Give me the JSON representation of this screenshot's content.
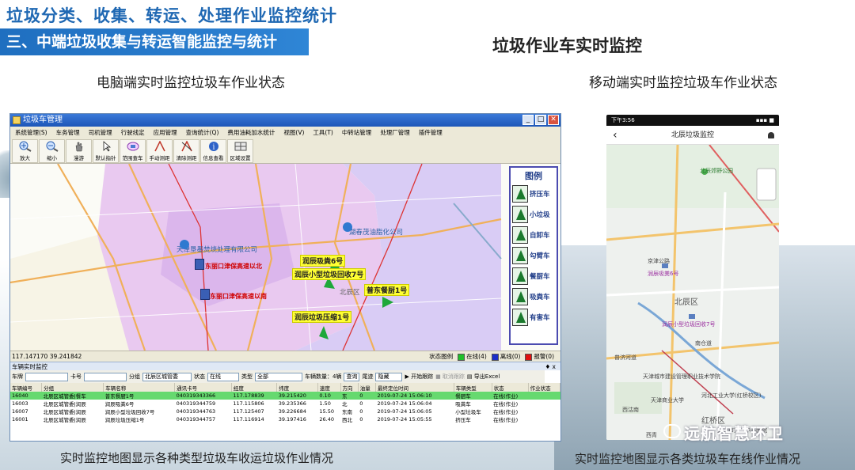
{
  "header": {
    "title": "垃圾分类、收集、转运、处理作业监控统计",
    "section": "三、中端垃圾收集与转运智能监控与统计",
    "right_title": "垃圾作业车实时监控"
  },
  "captions": {
    "pc": "电脑端实时监控垃圾车作业状态",
    "mobile": "移动端实时监控垃圾车作业状态",
    "pc_bottom": "实时监控地图显示各种类型垃圾车收运垃圾作业情况",
    "mobile_bottom": "实时监控地图显示各类垃圾车在线作业情况"
  },
  "window": {
    "title": "垃圾车管理",
    "buttons": [
      "_",
      "□",
      "✕"
    ],
    "menu": [
      "系统管理(S)",
      "车务管理",
      "司机管理",
      "行驶线定",
      "应用管理",
      "查询统计(Q)",
      "费用油耗加水统计",
      "视图(V)",
      "工具(T)",
      "中转站管理",
      "处理厂管理",
      "插件管理"
    ],
    "toolbar": [
      "放大",
      "缩小",
      "漫游",
      "默认指针",
      "范围查车",
      "手动测距",
      "清除测距",
      "信息查看",
      "区域设置"
    ]
  },
  "map": {
    "poi1": "天津垦墨焚烧处理有限公司",
    "poi2": "湖春茂油脂化公司",
    "tag1": "东丽口津保高速以北",
    "tag2": "东丽口津保高速以南",
    "district": "北辰区",
    "trucks": [
      "润辰吸粪6号",
      "润辰小型垃圾回收7号",
      "普东餐厨1号",
      "润辰垃圾压缩1号"
    ],
    "legend_title": "图例",
    "legend": [
      "挤压车",
      "小垃圾",
      "自卸车",
      "勾臂车",
      "餐厨车",
      "吸粪车",
      "有害车"
    ]
  },
  "status": {
    "coords": "117.147170   39.241842",
    "label": "状态图例",
    "online": "在线(4)",
    "offline": "离线(0)",
    "alarm": "报警(0)",
    "colors": {
      "online": "#1fbf2a",
      "offline": "#1c2fc8",
      "alarm": "#e01010"
    }
  },
  "panel": {
    "title": "车辆实时监控",
    "pin": "♦ x",
    "filters": {
      "plate_label": "车牌",
      "card_label": "卡号",
      "group_label": "分组",
      "group_value": "北辰区城管委",
      "state_label": "状态",
      "state_value": "在线",
      "type_label": "类型",
      "type_value": "全部",
      "count_label": "车辆数量：4辆",
      "query": "查询",
      "track_label": "尾迹",
      "track_value": "隐藏",
      "start_track": "开始跟踪",
      "cancel_track": "取消跟踪",
      "export": "导出Excel"
    },
    "columns": [
      "车辆编号",
      "分组",
      "车辆名称",
      "通讯卡号",
      "经度",
      "纬度",
      "速度",
      "方向",
      "油量",
      "最终定位时间",
      "车辆类型",
      "状态",
      "作业状态"
    ],
    "rows": [
      [
        "16040",
        "北辰区城管委|餐车",
        "普东餐厨1号",
        "040319343366",
        "117.178839",
        "39.215420",
        "0.10",
        "东",
        "0",
        "2019-07-24 15:06:10",
        "餐厨车",
        "在线(作业)",
        ""
      ],
      [
        "16003",
        "北辰区城管委|润辰",
        "润辰吸粪6号",
        "040319344759",
        "117.115806",
        "39.235366",
        "1.50",
        "北",
        "0",
        "2019-07-24 15:06:04",
        "吸粪车",
        "在线(作业)",
        ""
      ],
      [
        "16007",
        "北辰区城管委|润辰",
        "润辰小型垃圾回收7号",
        "040319344763",
        "117.125407",
        "39.226684",
        "15.50",
        "东南",
        "0",
        "2019-07-24 15:06:05",
        "小型垃圾车",
        "在线(作业)",
        ""
      ],
      [
        "16001",
        "北辰区城管委|润辰",
        "润辰垃圾压缩1号",
        "040319344757",
        "117.116914",
        "39.197416",
        "26.40",
        "西北",
        "0",
        "2019-07-24 15:05:55",
        "挤压车",
        "在线(作业)",
        ""
      ]
    ]
  },
  "phone": {
    "time": "下午3:56",
    "signal": "▪▪▪ ■",
    "nav_title": "北辰垃圾监控",
    "labels": {
      "park": "北辰郊野公园",
      "road1": "京津公路",
      "district": "北辰区",
      "truck1": "润辰吸粪6号",
      "truck2": "润辰小型垃圾回收7号",
      "road2": "南仓道",
      "school": "天津城市建设管理职业技术学院",
      "road3": "普济河道",
      "university": "河北工业大学(红桥校区)",
      "district2": "红桥区",
      "commerce": "天津商业大学",
      "hospital": "天津市第一中心医院",
      "area1": "西青",
      "road4": "西沽南"
    }
  },
  "watermark": "远航智慧环卫"
}
